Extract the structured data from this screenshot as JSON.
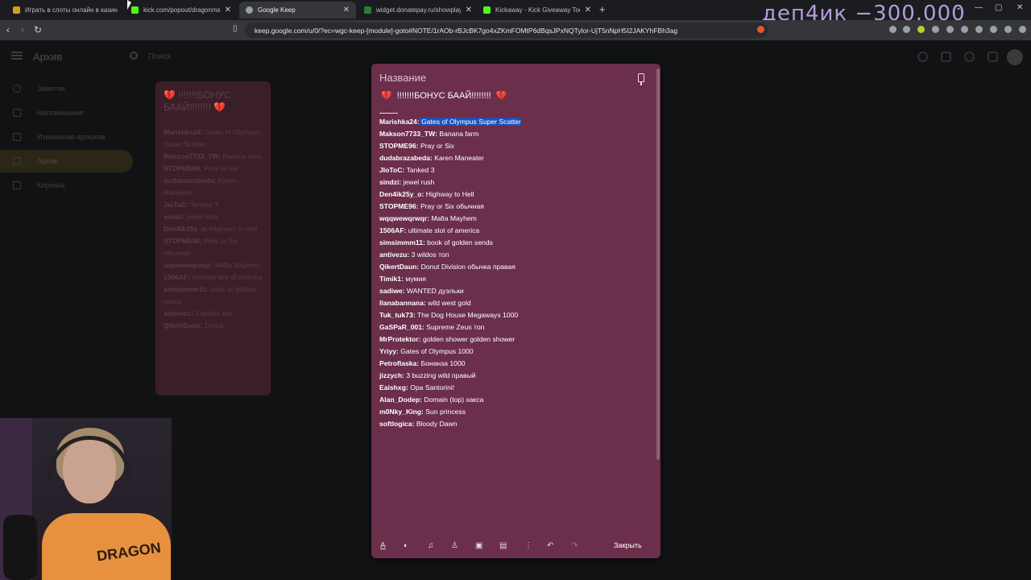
{
  "tabs": [
    {
      "title": "Играть в слоты онлайн в казин",
      "fav": "#d4a017",
      "active": false
    },
    {
      "title": "kick.com/popout/dragonmafia/c",
      "fav": "#53fc18",
      "active": false
    },
    {
      "title": "Google Keep",
      "fav": "#9aa0a6",
      "active": true
    },
    {
      "title": "widget.donatepay.ru/showplaye",
      "fav": "#2e7d32",
      "active": false
    },
    {
      "title": "Kickaway - Kick Giveaway Tool",
      "fav": "#53fc18",
      "active": false
    }
  ],
  "overlay": {
    "text": "деп4ик −300.000"
  },
  "url": "keep.google.com/u/0/?ec=wgc-keep-[module]-goto#NOTE/1rAOb-rBJcBK7go4xZKmFOMtP6dBqsJPxNQTylor-UjT5nNpH5I2JAKYhFBh3ag",
  "app": {
    "title": "Архив",
    "search_placeholder": "Поиск"
  },
  "sidebar": [
    {
      "label": "Заметки"
    },
    {
      "label": "Напоминания"
    },
    {
      "label": "Изменение ярлыков"
    },
    {
      "label": "Архив",
      "active": true
    },
    {
      "label": "Корзина"
    }
  ],
  "bg_card": {
    "title": "💔 !!!!!!!БОНУС БААЙ!!!!!!!! 💔",
    "lines": [
      {
        "u": "Marishka24:",
        "s": "Gates of Olympus Super Scatter"
      },
      {
        "u": "Makson7733_TW:",
        "s": "Banana farm"
      },
      {
        "u": "STOPME96:",
        "s": "Pray or Six"
      },
      {
        "u": "dudabrazabeda:",
        "s": "Karen Maneater"
      },
      {
        "u": "JloToC:",
        "s": "Tanked 3"
      },
      {
        "u": "sindzi:",
        "s": "jewel rush"
      },
      {
        "u": "Den4ik25y_o:",
        "s": "Highway to Hell"
      },
      {
        "u": "STOPME96:",
        "s": "Pray or Six обычная"
      },
      {
        "u": "wqqwewqrwqr:",
        "s": "Mafia Mayhem"
      },
      {
        "u": "1506AF:",
        "s": "ultimate slot of america"
      },
      {
        "u": "simsimmm11:",
        "s": "book of golden sends"
      },
      {
        "u": "antivezu:",
        "s": "3 wildos топ"
      },
      {
        "u": "QikertDaun:",
        "s": "Donut..."
      }
    ]
  },
  "note": {
    "name_placeholder": "Название",
    "heading": "!!!!!!!БОНУС БААЙ!!!!!!!!",
    "heart": "💔",
    "entries": [
      {
        "u": "Marishka24:",
        "s": "Gates of Olympus Super Scatter",
        "selected": true
      },
      {
        "u": "Makson7733_TW:",
        "s": "Banana farm"
      },
      {
        "u": "STOPME96:",
        "s": "Pray or Six"
      },
      {
        "u": "dudabrazabeda:",
        "s": "Karen Maneater"
      },
      {
        "u": "JloToC:",
        "s": "Tanked 3"
      },
      {
        "u": "sindzi:",
        "s": "jewel rush"
      },
      {
        "u": "Den4ik25y_o:",
        "s": "Highway to Hell"
      },
      {
        "u": "STOPME96:",
        "s": "Pray or Six обычная"
      },
      {
        "u": "wqqwewqrwqr:",
        "s": "Mafia Mayhem"
      },
      {
        "u": "1506AF:",
        "s": "ultimate slot of america"
      },
      {
        "u": "simsimmm11:",
        "s": "book of golden sends"
      },
      {
        "u": "antivezu:",
        "s": "3 wildos топ"
      },
      {
        "u": "QikertDaun:",
        "s": "Donut Division обычка правая"
      },
      {
        "u": "Timik1:",
        "s": "мумия"
      },
      {
        "u": "sadiwe:",
        "s": "WANTED дуэльки"
      },
      {
        "u": "llanabannana:",
        "s": "wild west gold"
      },
      {
        "u": "Tuk_tuk73:",
        "s": "The Dog House Megaways 1000"
      },
      {
        "u": "GaSPaR_001:",
        "s": "Supreme Zeus топ"
      },
      {
        "u": "MrProtektor:",
        "s": "golden shower golden shower"
      },
      {
        "u": "Yriyy:",
        "s": "Gates of Olympus 1000"
      },
      {
        "u": "Petroflaska:",
        "s": "Бонанза 1000"
      },
      {
        "u": "jizzych:",
        "s": "3 buzzing wild правый"
      },
      {
        "u": "Eaishxg:",
        "s": "Opa Santorini!"
      },
      {
        "u": "Alan_Dodep:",
        "s": "Domain (top) хакса"
      },
      {
        "u": "m0Nky_King:",
        "s": "Sun princess"
      },
      {
        "u": "softlogica:",
        "s": "Bloody Dawn"
      }
    ],
    "close_label": "Закрыть"
  },
  "webcam": {
    "shirt_text": "DRAGON"
  }
}
